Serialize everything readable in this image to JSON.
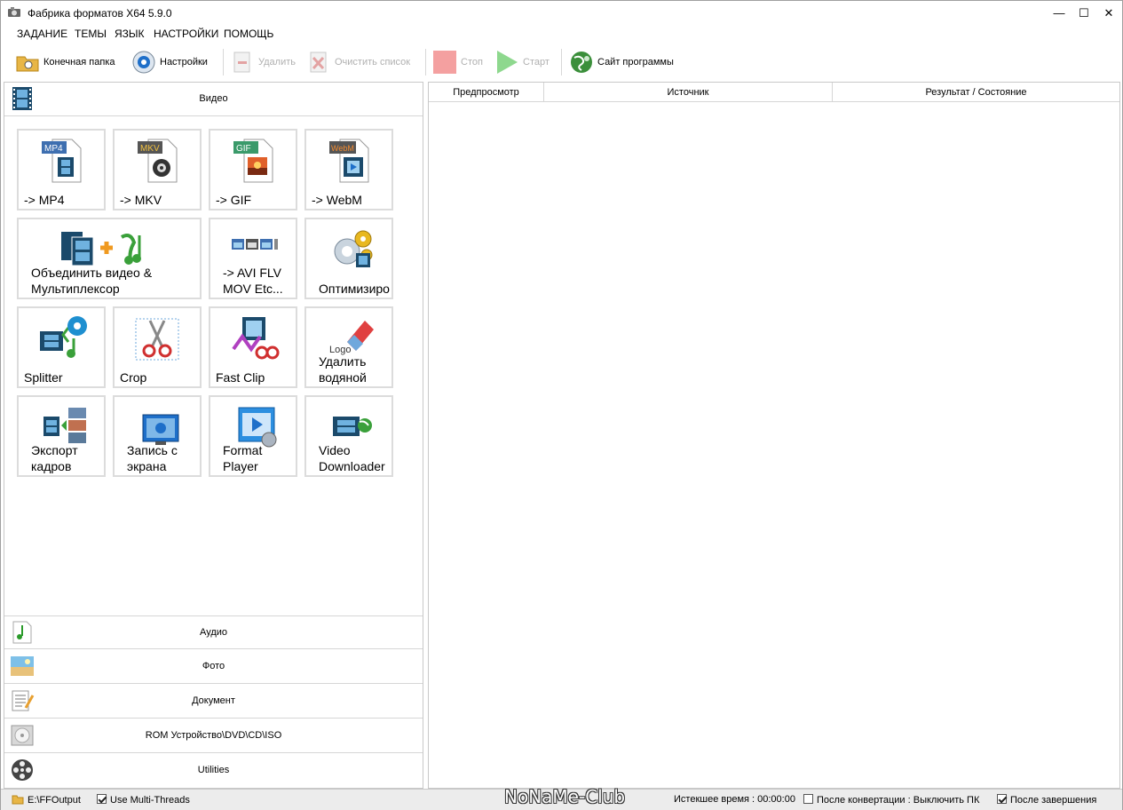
{
  "window": {
    "title": "Фабрика форматов X64 5.9.0",
    "minimize": "—",
    "maximize": "☐",
    "close": "✕"
  },
  "menu": [
    "ЗАДАНИЕ",
    "ТЕМЫ",
    "ЯЗЫК",
    "НАСТРОЙКИ",
    "ПОМОЩЬ"
  ],
  "toolbar": {
    "output_folder": "Конечная папка",
    "settings": "Настройки",
    "delete": "Удалить",
    "clear_list": "Очистить список",
    "stop": "Стоп",
    "start": "Старт",
    "website": "Сайт программы"
  },
  "categories": {
    "video": "Видео",
    "audio": "Аудио",
    "photo": "Фото",
    "document": "Документ",
    "rom": "ROM Устройство\\DVD\\CD\\ISO",
    "utilities": "Utilities"
  },
  "tiles": [
    {
      "label": "-> MP4",
      "badge": "MP4"
    },
    {
      "label": "-> MKV",
      "badge": "MKV"
    },
    {
      "label": "-> GIF",
      "badge": "GIF"
    },
    {
      "label": "-> WebM",
      "badge": "WebM"
    },
    {
      "label": "Объединить видео &\nМультиплексор"
    },
    {
      "label": "-> AVI FLV\nMOV Etc..."
    },
    {
      "label": "Оптимизиро"
    },
    {
      "label": "Splitter"
    },
    {
      "label": "Crop"
    },
    {
      "label": "Fast Clip"
    },
    {
      "label": "Удалить\nводяной",
      "badge": "Logo"
    },
    {
      "label": "Экспорт\nкадров"
    },
    {
      "label": "Запись с\nэкрана"
    },
    {
      "label": "Format\nPlayer"
    },
    {
      "label": "Video\nDownloader"
    }
  ],
  "table": {
    "columns": [
      "Предпросмотр",
      "Источник",
      "Результат / Состояние"
    ]
  },
  "status": {
    "path": "E:\\FFOutput",
    "multithreads": "Use Multi-Threads",
    "elapsed": "Истекшее время : 00:00:00",
    "after_conversion": "После конвертации : Выключить ПК",
    "after_finish": "После завершения",
    "watermark": "NoNaMe-Club"
  },
  "colors": {
    "accent": "#1e6fc9",
    "stop": "#f4a0a0",
    "start": "#8ed88e",
    "panel_border": "#c8c8c8"
  }
}
